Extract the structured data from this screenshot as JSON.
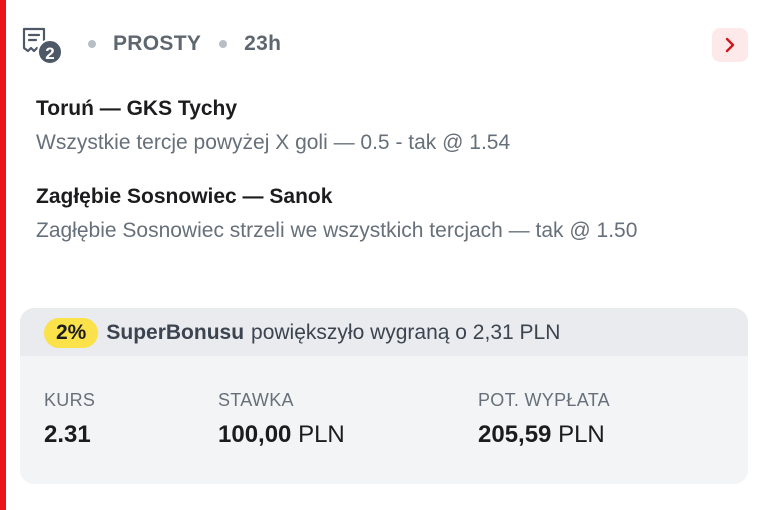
{
  "header": {
    "bet_count": "2",
    "bet_type": "PROSTY",
    "time_ago": "23h",
    "icon": "ticket-icon",
    "chevron_icon": "chevron-right-icon"
  },
  "selections": [
    {
      "match": "Toruń — GKS Tychy",
      "bet": "Wszystkie tercje powyżej X goli — 0.5 - tak @ 1.54"
    },
    {
      "match": "Zagłębie Sosnowiec — Sanok",
      "bet": "Zagłębie Sosnowiec strzeli we wszystkich tercjach — tak @ 1.50"
    }
  ],
  "bonus": {
    "percent": "2%",
    "name": "SuperBonusu",
    "text": "powiększyło wygraną o 2,31 PLN"
  },
  "stats": {
    "odds_label": "KURS",
    "odds_value": "2.31",
    "stake_label": "STAWKA",
    "stake_value": "100,00",
    "stake_unit": "PLN",
    "payout_label": "POT. WYPŁATA",
    "payout_value": "205,59",
    "payout_unit": "PLN"
  },
  "colors": {
    "accent": "#e8151b",
    "bonus_badge": "#fbe14a",
    "badge_bg": "#4e5866"
  }
}
